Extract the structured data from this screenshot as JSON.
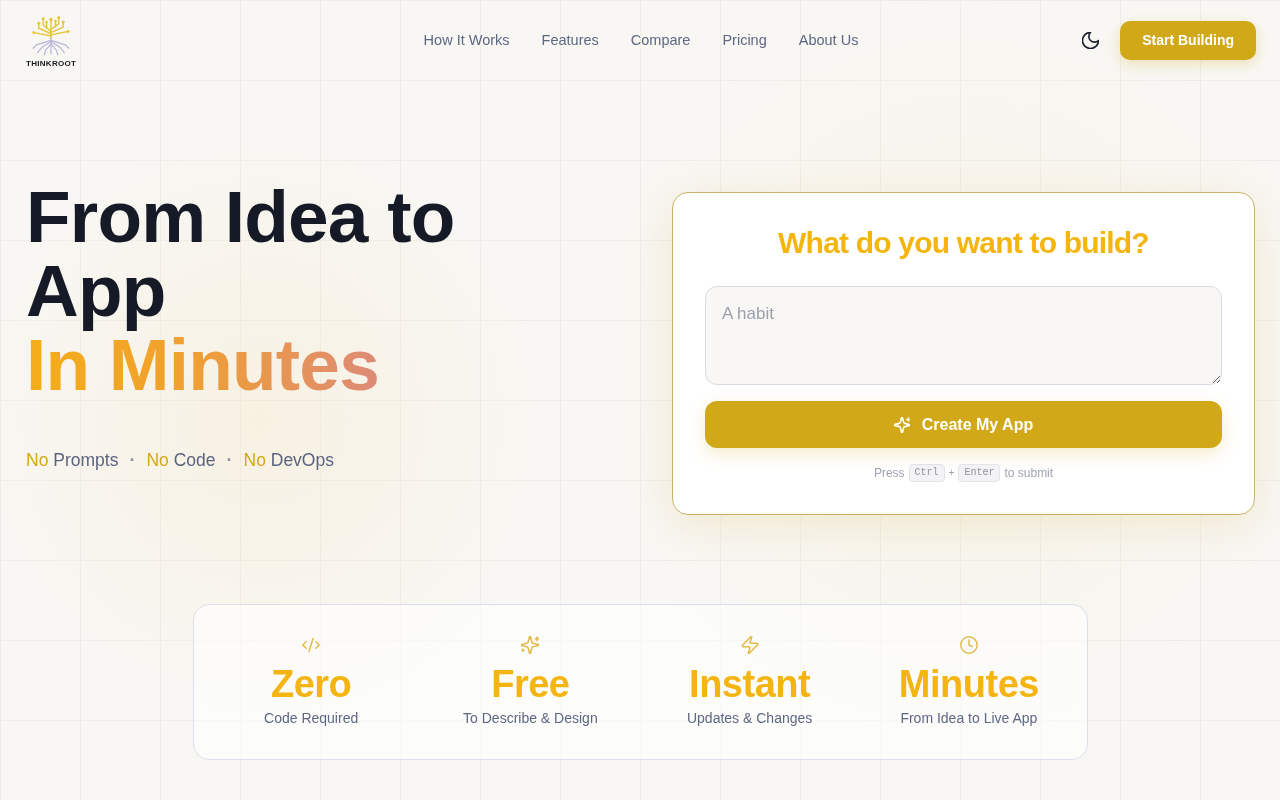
{
  "header": {
    "logo": {
      "text": "THINKROOT"
    },
    "nav": [
      {
        "label": "How It Works"
      },
      {
        "label": "Features"
      },
      {
        "label": "Compare"
      },
      {
        "label": "Pricing"
      },
      {
        "label": "About Us"
      }
    ],
    "cta": {
      "label": "Start Building"
    }
  },
  "hero": {
    "title": "From Idea to App",
    "highlight": "In Minutes",
    "taglines": [
      {
        "lead": "No",
        "text": "Prompts"
      },
      {
        "separator": "·",
        "lead": "No",
        "text": "Code"
      },
      {
        "separator": "·",
        "lead": "No",
        "text": "DevOps"
      }
    ]
  },
  "builder": {
    "title": "What do you want to build?",
    "prompt": {
      "placeholder": "A habit"
    },
    "submit": {
      "label": "Create My App"
    },
    "hint": {
      "before": "Press",
      "keys": [
        {
          "label": "Ctrl"
        },
        {
          "label": "Enter"
        }
      ],
      "joiner": "+",
      "after": "to submit"
    }
  },
  "stats": [
    {
      "value": "Zero",
      "label": "Code Required"
    },
    {
      "value": "Free",
      "label": "To Describe & Design"
    },
    {
      "value": "Instant",
      "label": "Updates & Changes"
    },
    {
      "value": "Minutes",
      "label": "From Idea to Live App"
    }
  ]
}
